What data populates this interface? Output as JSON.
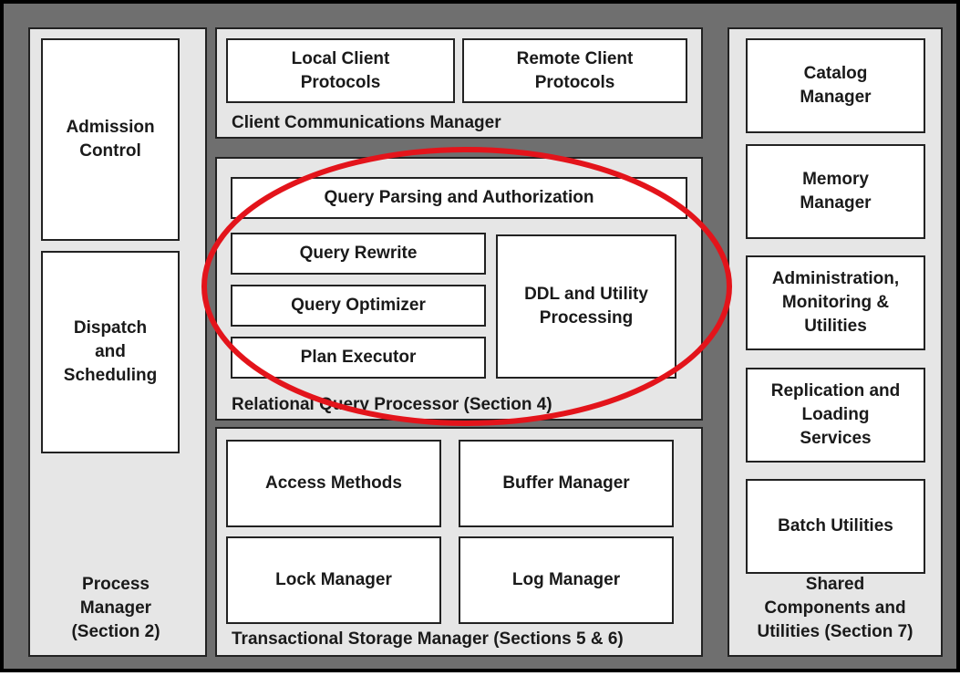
{
  "process_manager": {
    "admission_control": "Admission\nControl",
    "dispatch_scheduling": "Dispatch\nand\nScheduling",
    "title": "Process\nManager\n(Section 2)"
  },
  "client_comm": {
    "local": "Local Client\nProtocols",
    "remote": "Remote Client\nProtocols",
    "title": "Client Communications Manager"
  },
  "query_processor": {
    "parsing": "Query Parsing and Authorization",
    "rewrite": "Query Rewrite",
    "optimizer": "Query Optimizer",
    "executor": "Plan Executor",
    "ddl": "DDL and Utility\nProcessing",
    "title": "Relational Query Processor (Section 4)"
  },
  "storage": {
    "access": "Access Methods",
    "buffer": "Buffer Manager",
    "lock": "Lock Manager",
    "log": "Log Manager",
    "title": "Transactional Storage Manager (Sections 5 & 6)"
  },
  "shared": {
    "catalog": "Catalog\nManager",
    "memory": "Memory\nManager",
    "admin": "Administration,\nMonitoring &\nUtilities",
    "replication": "Replication and\nLoading\nServices",
    "batch": "Batch Utilities",
    "title": "Shared\nComponents and\nUtilities (Section 7)"
  },
  "colors": {
    "background": "#6f6f6f",
    "panel": "#e6e6e6",
    "box": "#ffffff",
    "highlight": "#e3141b"
  }
}
